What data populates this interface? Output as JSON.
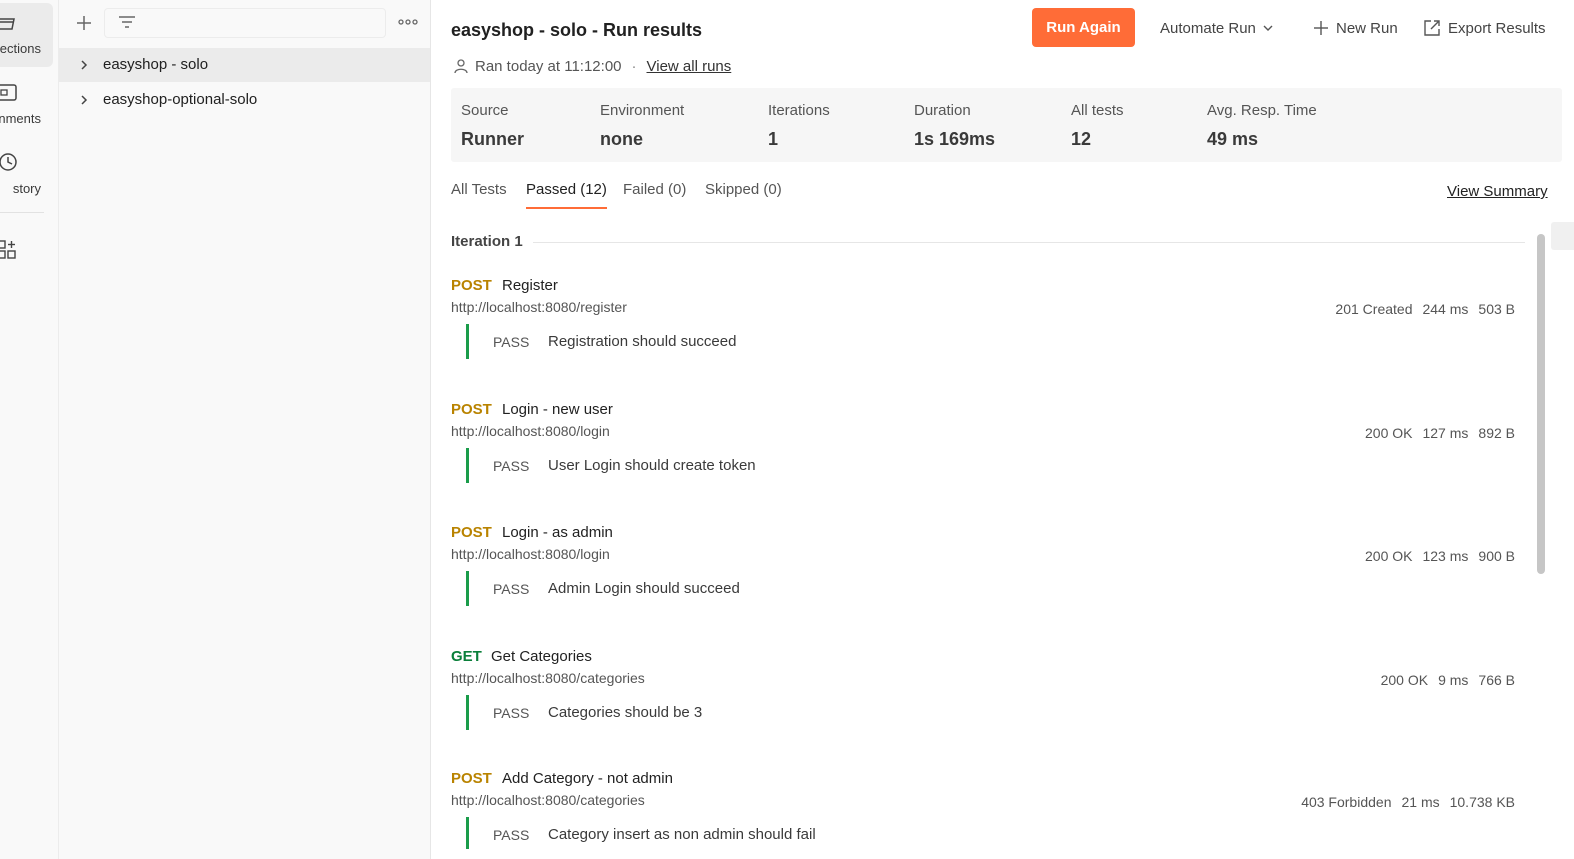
{
  "rail": {
    "items": [
      {
        "label": "ections",
        "icon": "collections-icon"
      },
      {
        "label": "onments",
        "icon": "environments-icon"
      },
      {
        "label": "story",
        "icon": "history-icon"
      },
      {
        "icon": "apps-icon"
      }
    ]
  },
  "sidebar": {
    "collections": [
      {
        "name": "easyshop - solo"
      },
      {
        "name": "easyshop-optional-solo"
      }
    ]
  },
  "header": {
    "title": "easyshop - solo - Run results",
    "ran_text": "Ran today at 11:12:00",
    "separator": "·",
    "view_all_runs": "View all runs",
    "run_again": "Run Again",
    "automate_run": "Automate Run",
    "new_run": "New Run",
    "export_results": "Export Results"
  },
  "stats": [
    {
      "label": "Source",
      "value": "Runner"
    },
    {
      "label": "Environment",
      "value": "none"
    },
    {
      "label": "Iterations",
      "value": "1"
    },
    {
      "label": "Duration",
      "value": "1s 169ms"
    },
    {
      "label": "All tests",
      "value": "12"
    },
    {
      "label": "Avg. Resp. Time",
      "value": "49 ms"
    }
  ],
  "tabs": [
    {
      "label": "All Tests"
    },
    {
      "label": "Passed (12)",
      "active": true
    },
    {
      "label": "Failed (0)"
    },
    {
      "label": "Skipped (0)"
    }
  ],
  "view_summary": "View Summary",
  "iteration_label": "Iteration 1",
  "colors": {
    "accent": "#ff6c37",
    "post": "#b98300",
    "get": "#0a7f3a",
    "pass": "#1a9c4a"
  },
  "requests": [
    {
      "method": "POST",
      "name": "Register",
      "url": "http://localhost:8080/register",
      "status": "201 Created",
      "time": "244 ms",
      "size": "503 B",
      "test_result": "PASS",
      "test_name": "Registration should succeed"
    },
    {
      "method": "POST",
      "name": "Login - new user",
      "url": "http://localhost:8080/login",
      "status": "200 OK",
      "time": "127 ms",
      "size": "892 B",
      "test_result": "PASS",
      "test_name": "User Login should create token"
    },
    {
      "method": "POST",
      "name": "Login - as admin",
      "url": "http://localhost:8080/login",
      "status": "200 OK",
      "time": "123 ms",
      "size": "900 B",
      "test_result": "PASS",
      "test_name": "Admin Login should succeed"
    },
    {
      "method": "GET",
      "name": "Get Categories",
      "url": "http://localhost:8080/categories",
      "status": "200 OK",
      "time": "9 ms",
      "size": "766 B",
      "test_result": "PASS",
      "test_name": "Categories should be 3"
    },
    {
      "method": "POST",
      "name": "Add Category - not admin",
      "url": "http://localhost:8080/categories",
      "status": "403 Forbidden",
      "time": "21 ms",
      "size": "10.738 KB",
      "test_result": "PASS",
      "test_name": "Category insert as non admin should fail"
    }
  ]
}
